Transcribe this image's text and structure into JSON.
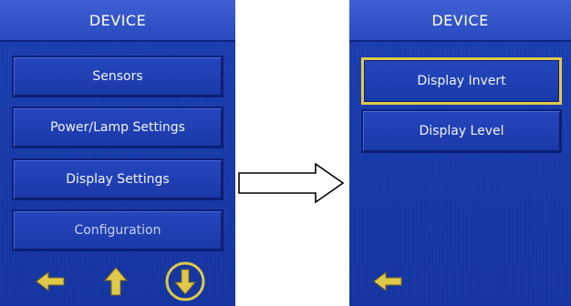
{
  "left_screen": {
    "title": "DEVICE",
    "menu_items": [
      {
        "label": "Sensors"
      },
      {
        "label": "Power/Lamp Settings"
      },
      {
        "label": "Display Settings"
      },
      {
        "label": "Configuration"
      }
    ],
    "nav": {
      "back_icon": "arrow-left-icon",
      "up_icon": "arrow-up-icon",
      "down_icon": "arrow-down-circle-icon"
    }
  },
  "right_screen": {
    "title": "DEVICE",
    "menu_items": [
      {
        "label": "Display Invert",
        "selected": true
      },
      {
        "label": "Display Level",
        "selected": false
      }
    ],
    "nav": {
      "back_icon": "arrow-left-icon"
    }
  },
  "transition_icon": "arrow-right-outline-icon",
  "colors": {
    "screen_bg": "#1638a6",
    "header_bg": "#2a4bc0",
    "button_border": "#0b1f7a",
    "selected_border": "#e0c94a",
    "icon_yellow": "#e0c94a"
  }
}
